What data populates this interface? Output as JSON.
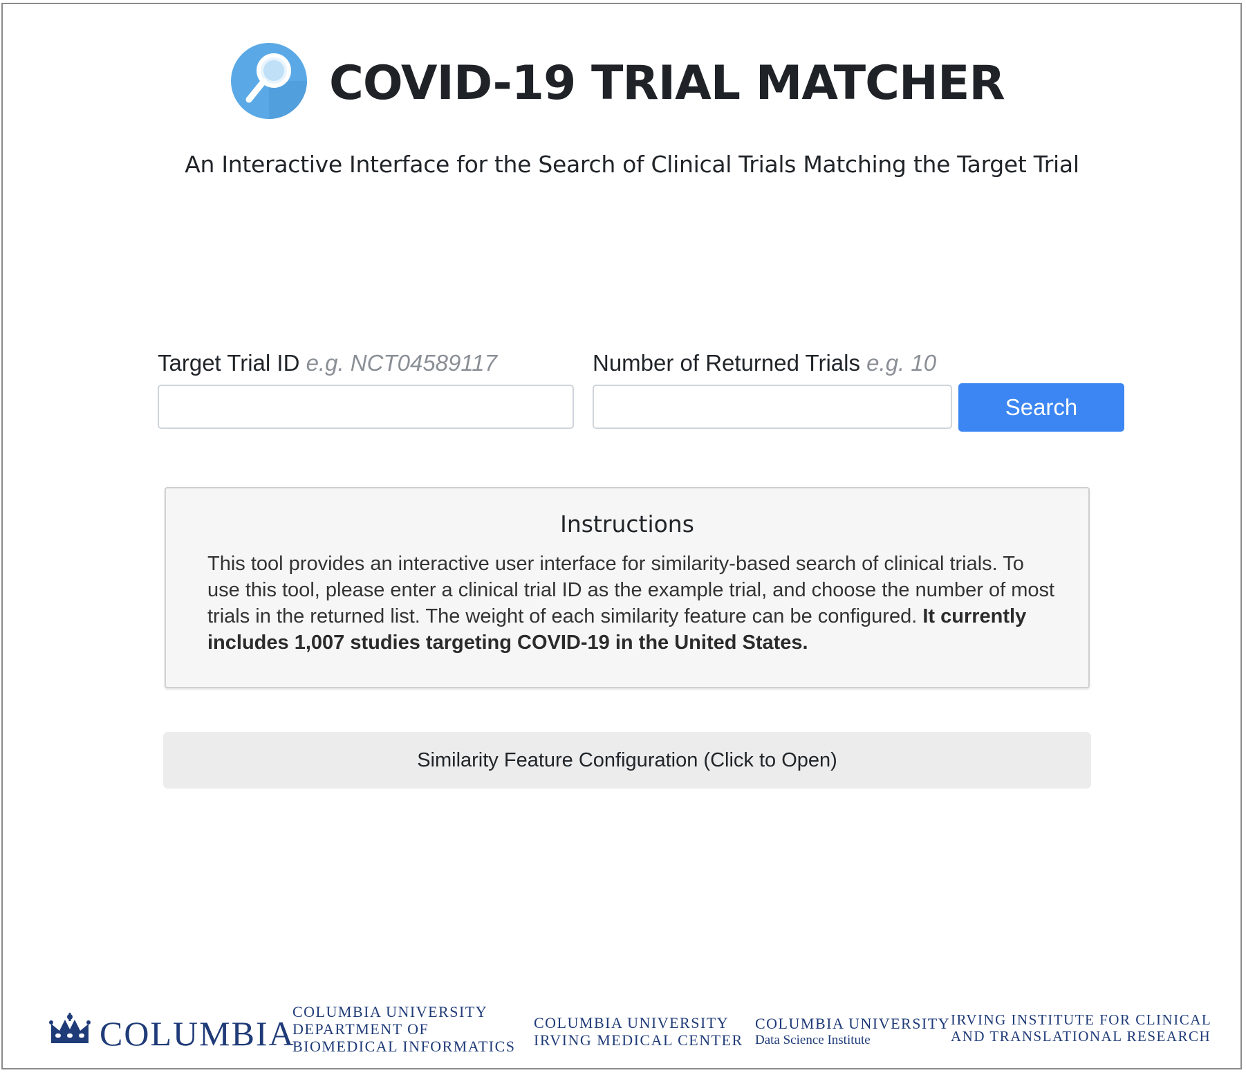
{
  "header": {
    "logo_icon": "magnifier-icon",
    "title": "COVID-19 TRIAL MATCHER",
    "subtitle": "An Interactive Interface for the Search of Clinical Trials Matching the Target Trial"
  },
  "search_form": {
    "target_trial": {
      "label": "Target Trial ID",
      "hint": "e.g. NCT04589117",
      "value": ""
    },
    "returned_trials": {
      "label": "Number of Returned Trials",
      "hint": "e.g. 10",
      "value": ""
    },
    "search_button_label": "Search"
  },
  "instructions": {
    "title": "Instructions",
    "body": "This tool provides an interactive user interface for similarity-based search of clinical trials. To use this tool, please enter a clinical trial ID as the example trial, and choose the number of most trials in the returned list. The weight of each similarity feature can be configured.",
    "body_bold": "It currently includes 1,007 studies targeting COVID-19 in the United States."
  },
  "config_toggle": {
    "label": "Similarity Feature Configuration (Click to Open)"
  },
  "footer": {
    "columbia": {
      "icon": "crown-icon",
      "wordmark": "Columbia"
    },
    "dbmi": {
      "line1": "Columbia University",
      "line2": "Department of",
      "line3": "Biomedical Informatics"
    },
    "cuimc": {
      "line1": "Columbia University",
      "line2": "Irving Medical Center"
    },
    "dsi": {
      "line1": "Columbia University",
      "line2": "Data Science Institute"
    },
    "irving_institute": {
      "line1": "Irving Institute for Clinical",
      "line2": "and Translational Research"
    }
  },
  "colors": {
    "primary_button": "#3b86f2",
    "logo_blue": "#5aa9e6",
    "brand_navy": "#1f3b78",
    "panel_bg": "#f6f6f6",
    "config_bg": "#ececec"
  }
}
